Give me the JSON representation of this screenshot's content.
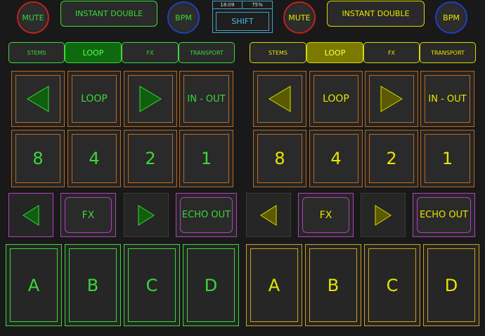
{
  "colors": {
    "left_accent": "#3ad83a",
    "right_accent": "#e6e600",
    "mute_ring": "#c22020",
    "bpm_ring": "#2040c0",
    "pad_border": "#b96a1e",
    "fx_border": "#b040c0",
    "shift_accent": "#4fb8e0"
  },
  "top": {
    "left": {
      "mute": "MUTE",
      "instant": "INSTANT DOUBLE",
      "bpm": "BPM"
    },
    "right": {
      "mute": "MUTE",
      "instant": "INSTANT DOUBLE",
      "bpm": "BPM"
    },
    "status": {
      "time": "18:09",
      "battery": "75%"
    },
    "shift": "SHIFT"
  },
  "tabs": {
    "left": [
      "STEMS",
      "LOOP",
      "FX",
      "TRANSPORT"
    ],
    "right": [
      "STEMS",
      "LOOP",
      "FX",
      "TRANSPORT"
    ],
    "active_index": 1
  },
  "loop_row": {
    "left": {
      "loop": "LOOP",
      "in_out": "IN - OUT"
    },
    "right": {
      "loop": "LOOP",
      "in_out": "IN - OUT"
    }
  },
  "beat_row": {
    "left": [
      "8",
      "4",
      "2",
      "1"
    ],
    "right": [
      "8",
      "4",
      "2",
      "1"
    ]
  },
  "fx_row": {
    "left": {
      "fx": "FX",
      "echo": "ECHO OUT"
    },
    "right": {
      "fx": "FX",
      "echo": "ECHO OUT"
    }
  },
  "cue_row": {
    "left": [
      "A",
      "B",
      "C",
      "D"
    ],
    "right": [
      "A",
      "B",
      "C",
      "D"
    ]
  },
  "icons": {
    "arrow_left": "triangle-left-icon",
    "arrow_right": "triangle-right-icon"
  }
}
